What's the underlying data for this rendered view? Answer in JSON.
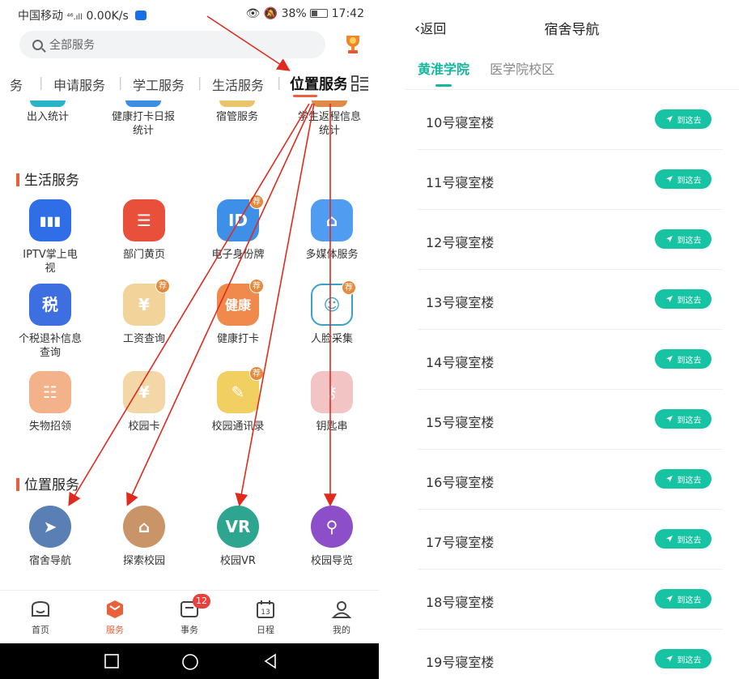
{
  "left": {
    "status": {
      "carrier": "中国移动",
      "signal": "⁴⁶.ıll",
      "speed": "0.00K/s",
      "battery": "38%",
      "time": "17:42"
    },
    "search_placeholder": "全部服务",
    "tabs": [
      "务",
      "申请服务",
      "学工服务",
      "生活服务",
      "位置服务"
    ],
    "partial_row": [
      {
        "label": "出入统计",
        "color": "#2bb3c9"
      },
      {
        "label": "健康打卡日报统计",
        "color": "#3b8de6"
      },
      {
        "label": "宿管服务",
        "color": "#e9c46a"
      },
      {
        "label": "学生返程信息统计",
        "color": "#e08a4a"
      }
    ],
    "life_title": "生活服务",
    "life_apps": [
      {
        "label": "IPTV掌上电视",
        "icon": "tv-icon",
        "glyph": "▮▮▮",
        "color": "#2f6ee6",
        "rec": false
      },
      {
        "label": "部门黄页",
        "icon": "directory-icon",
        "glyph": "☰",
        "color": "#e8503c",
        "rec": false
      },
      {
        "label": "电子身份牌",
        "icon": "id-card-icon",
        "glyph": "ID",
        "color": "#3d8fe8",
        "rec": true
      },
      {
        "label": "多媒体服务",
        "icon": "home-icon",
        "glyph": "⌂",
        "color": "#4f9cf0",
        "rec": false
      },
      {
        "label": "个税退补信息查询",
        "icon": "tax-icon",
        "glyph": "税",
        "color": "#3d6fe0",
        "rec": false
      },
      {
        "label": "工资查询",
        "icon": "salary-icon",
        "glyph": "¥",
        "color": "#f2d49a",
        "rec": true
      },
      {
        "label": "健康打卡",
        "icon": "health-icon",
        "glyph": "健康",
        "color": "#f08a4c",
        "rec": true
      },
      {
        "label": "人脸采集",
        "icon": "face-icon",
        "glyph": "☺",
        "color": "#ffffff",
        "rec": true
      },
      {
        "label": "失物招领",
        "icon": "lost-found-icon",
        "glyph": "☷",
        "color": "#f3b28a",
        "rec": false
      },
      {
        "label": "校园卡",
        "icon": "campus-card-icon",
        "glyph": "¥",
        "color": "#f3d7a6",
        "rec": false
      },
      {
        "label": "校园通讯录",
        "icon": "contacts-icon",
        "glyph": "✎",
        "color": "#f1cf60",
        "rec": true
      },
      {
        "label": "钥匙串",
        "icon": "key-icon",
        "glyph": "⚷",
        "color": "#f2c4c4",
        "rec": false
      }
    ],
    "location_title": "位置服务",
    "location_apps": [
      {
        "label": "宿舍导航",
        "icon": "navigation-arrow-icon",
        "glyph": "➤",
        "color": "#5a7fb5"
      },
      {
        "label": "探索校园",
        "icon": "building-icon",
        "glyph": "⌂",
        "color": "#c99468"
      },
      {
        "label": "校园VR",
        "icon": "vr-icon",
        "glyph": "VR",
        "color": "#2ea68f"
      },
      {
        "label": "校园导览",
        "icon": "map-pin-icon",
        "glyph": "⚲",
        "color": "#8c4fc9"
      }
    ],
    "rec_badge": "荐",
    "nav": [
      {
        "label": "首页",
        "icon": "home-nav-icon"
      },
      {
        "label": "服务",
        "icon": "service-nav-icon"
      },
      {
        "label": "事务",
        "icon": "affairs-nav-icon",
        "badge": "12"
      },
      {
        "label": "日程",
        "icon": "calendar-nav-icon"
      },
      {
        "label": "我的",
        "icon": "profile-nav-icon"
      }
    ]
  },
  "right": {
    "back_label": "返回",
    "title": "宿舍导航",
    "campus_tabs": [
      "黄淮学院",
      "医学院校区"
    ],
    "go_label": "到这去",
    "dorms": [
      "10号寝室楼",
      "11号寝室楼",
      "12号寝室楼",
      "13号寝室楼",
      "14号寝室楼",
      "15号寝室楼",
      "16号寝室楼",
      "17号寝室楼",
      "18号寝室楼",
      "19号寝室楼"
    ]
  },
  "colors": {
    "accent_orange": "#e8603c",
    "accent_green": "#14b89c",
    "annotation_red": "#e02a1e"
  }
}
